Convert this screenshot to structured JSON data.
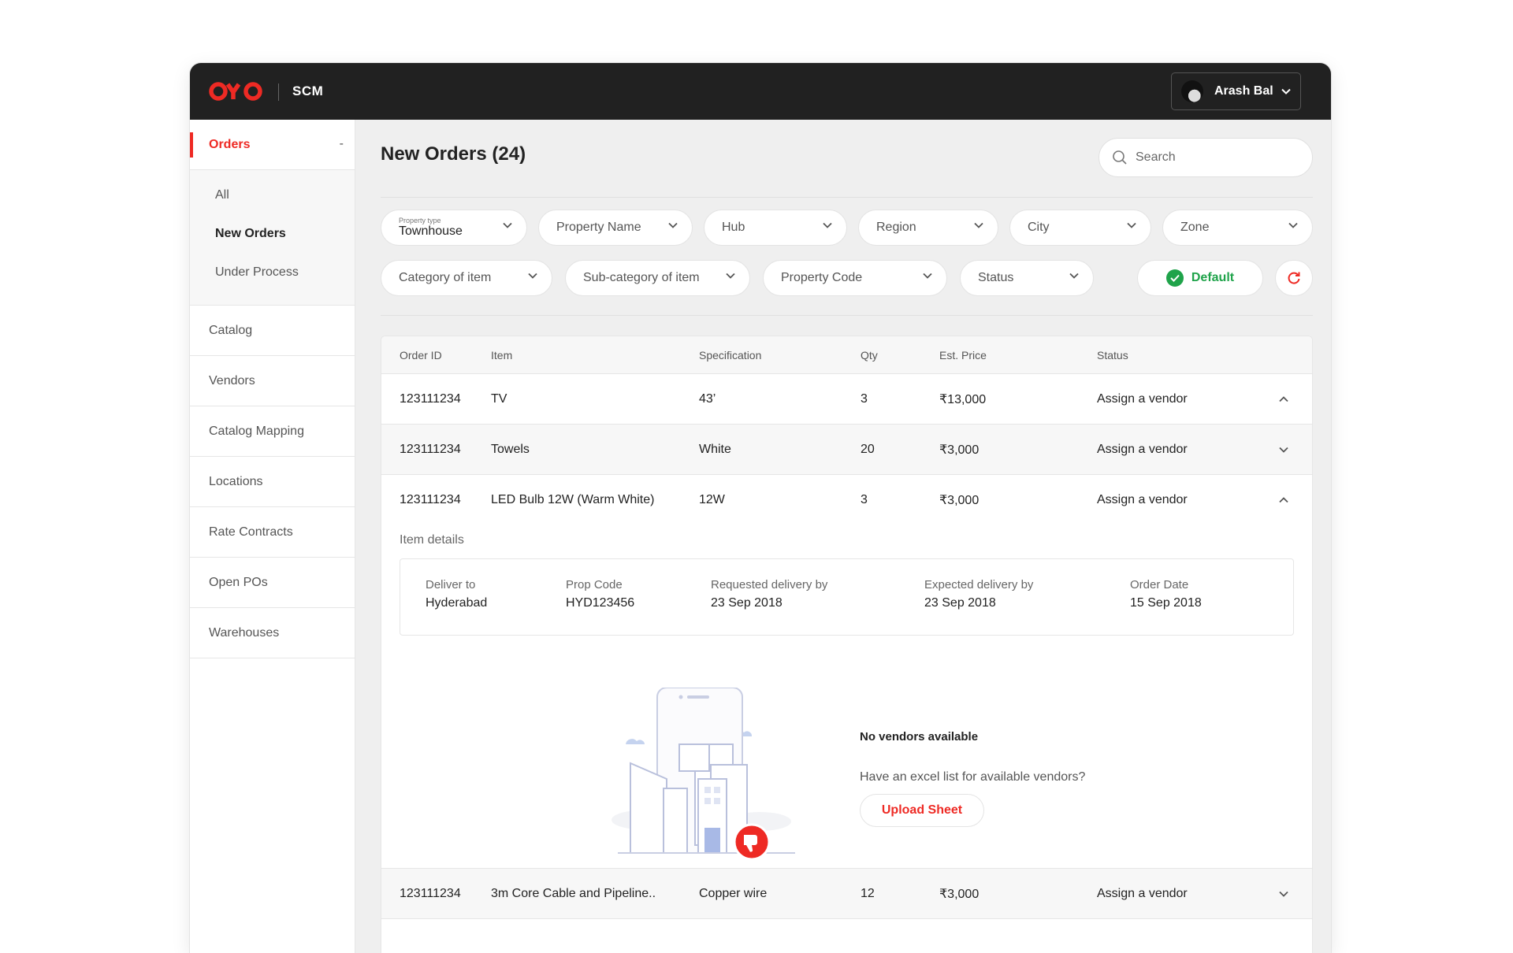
{
  "header": {
    "brand": "OYO",
    "app_name": "SCM",
    "user_name": "Arash Bal"
  },
  "sidebar": {
    "sections": [
      {
        "label": "Orders",
        "expanded": true,
        "collapse_symbol": "-"
      }
    ],
    "sub_items": [
      {
        "label": "All",
        "active": false
      },
      {
        "label": "New Orders",
        "active": true
      },
      {
        "label": "Under Process",
        "active": false
      }
    ],
    "items": [
      {
        "label": "Catalog"
      },
      {
        "label": "Vendors"
      },
      {
        "label": "Catalog Mapping"
      },
      {
        "label": "Locations"
      },
      {
        "label": "Rate Contracts"
      },
      {
        "label": "Open POs"
      },
      {
        "label": "Warehouses"
      }
    ]
  },
  "main": {
    "title": "New Orders (24)",
    "search_placeholder": "Search",
    "filters": {
      "property_type_label": "Property type",
      "property_type_value": "Townhouse",
      "property_name": "Property Name",
      "hub": "Hub",
      "region": "Region",
      "city": "City",
      "zone": "Zone",
      "category": "Category of item",
      "sub_category": "Sub-category of item",
      "property_code": "Property Code",
      "status": "Status",
      "default_label": "Default"
    },
    "table": {
      "headers": [
        "Order ID",
        "Item",
        "Specification",
        "Qty",
        "Est. Price",
        "Status"
      ],
      "rows": [
        {
          "order_id": "123111234",
          "item": "TV",
          "spec": "43’",
          "qty": "3",
          "price": "₹13,000",
          "status": "Assign a vendor",
          "expanded": false,
          "chevron": "up"
        },
        {
          "order_id": "123111234",
          "item": "Towels",
          "spec": "White",
          "qty": "20",
          "price": "₹3,000",
          "status": "Assign a vendor",
          "expanded": false,
          "chevron": "down"
        },
        {
          "order_id": "123111234",
          "item": "LED Bulb 12W (Warm White)",
          "spec": "12W",
          "qty": "3",
          "price": "₹3,000",
          "status": "Assign a vendor",
          "expanded": true,
          "chevron": "up"
        },
        {
          "order_id": "123111234",
          "item": "3m Core Cable and Pipeline..",
          "spec": "Copper wire",
          "qty": "12",
          "price": "₹3,000",
          "status": "Assign a vendor",
          "expanded": false,
          "chevron": "down"
        }
      ],
      "expanded_details": {
        "label": "Item details",
        "fields": [
          {
            "key": "Deliver to",
            "value": "Hyderabad"
          },
          {
            "key": "Prop Code",
            "value": "HYD123456"
          },
          {
            "key": "Requested delivery by",
            "value": "23 Sep 2018"
          },
          {
            "key": "Expected delivery by",
            "value": "23 Sep 2018"
          },
          {
            "key": "Order Date",
            "value": "15 Sep 2018"
          }
        ],
        "empty_state": {
          "title": "No vendors available",
          "subtitle": "Have an excel list for available vendors?",
          "button": "Upload Sheet"
        }
      }
    }
  },
  "colors": {
    "brand_red": "#ee2a24",
    "success_green": "#1fa34a",
    "topbar": "#212121"
  },
  "icons": [
    "chevron-down-icon",
    "chevron-up-icon",
    "search-icon",
    "check-circle-icon",
    "refresh-icon",
    "thumbs-down-icon"
  ]
}
